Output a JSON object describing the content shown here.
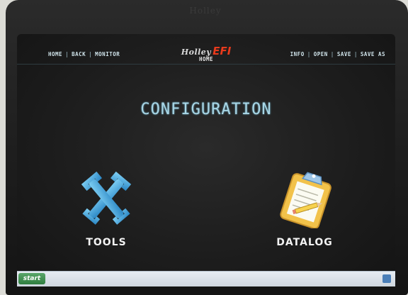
{
  "nav": {
    "left": [
      "HOME",
      "BACK",
      "MONITOR"
    ],
    "right": [
      "INFO",
      "OPEN",
      "SAVE",
      "SAVE AS"
    ],
    "separator": "|"
  },
  "brand": {
    "name": "Holley",
    "efi": "EFI",
    "subtitle": "HOME"
  },
  "page": {
    "title": "CONFIGURATION"
  },
  "tiles": [
    {
      "label": "TOOLS",
      "icon": "wrench-icon"
    },
    {
      "label": "DATALOG",
      "icon": "clipboard-icon"
    }
  ],
  "bezel": {
    "logo": "Holley"
  },
  "taskbar": {
    "start": "start"
  },
  "colors": {
    "accent": "#a9d6e6",
    "brand_red": "#e83a1c",
    "wrench_blue": "#3fa3d9",
    "clipboard_gold": "#f2c24a"
  }
}
